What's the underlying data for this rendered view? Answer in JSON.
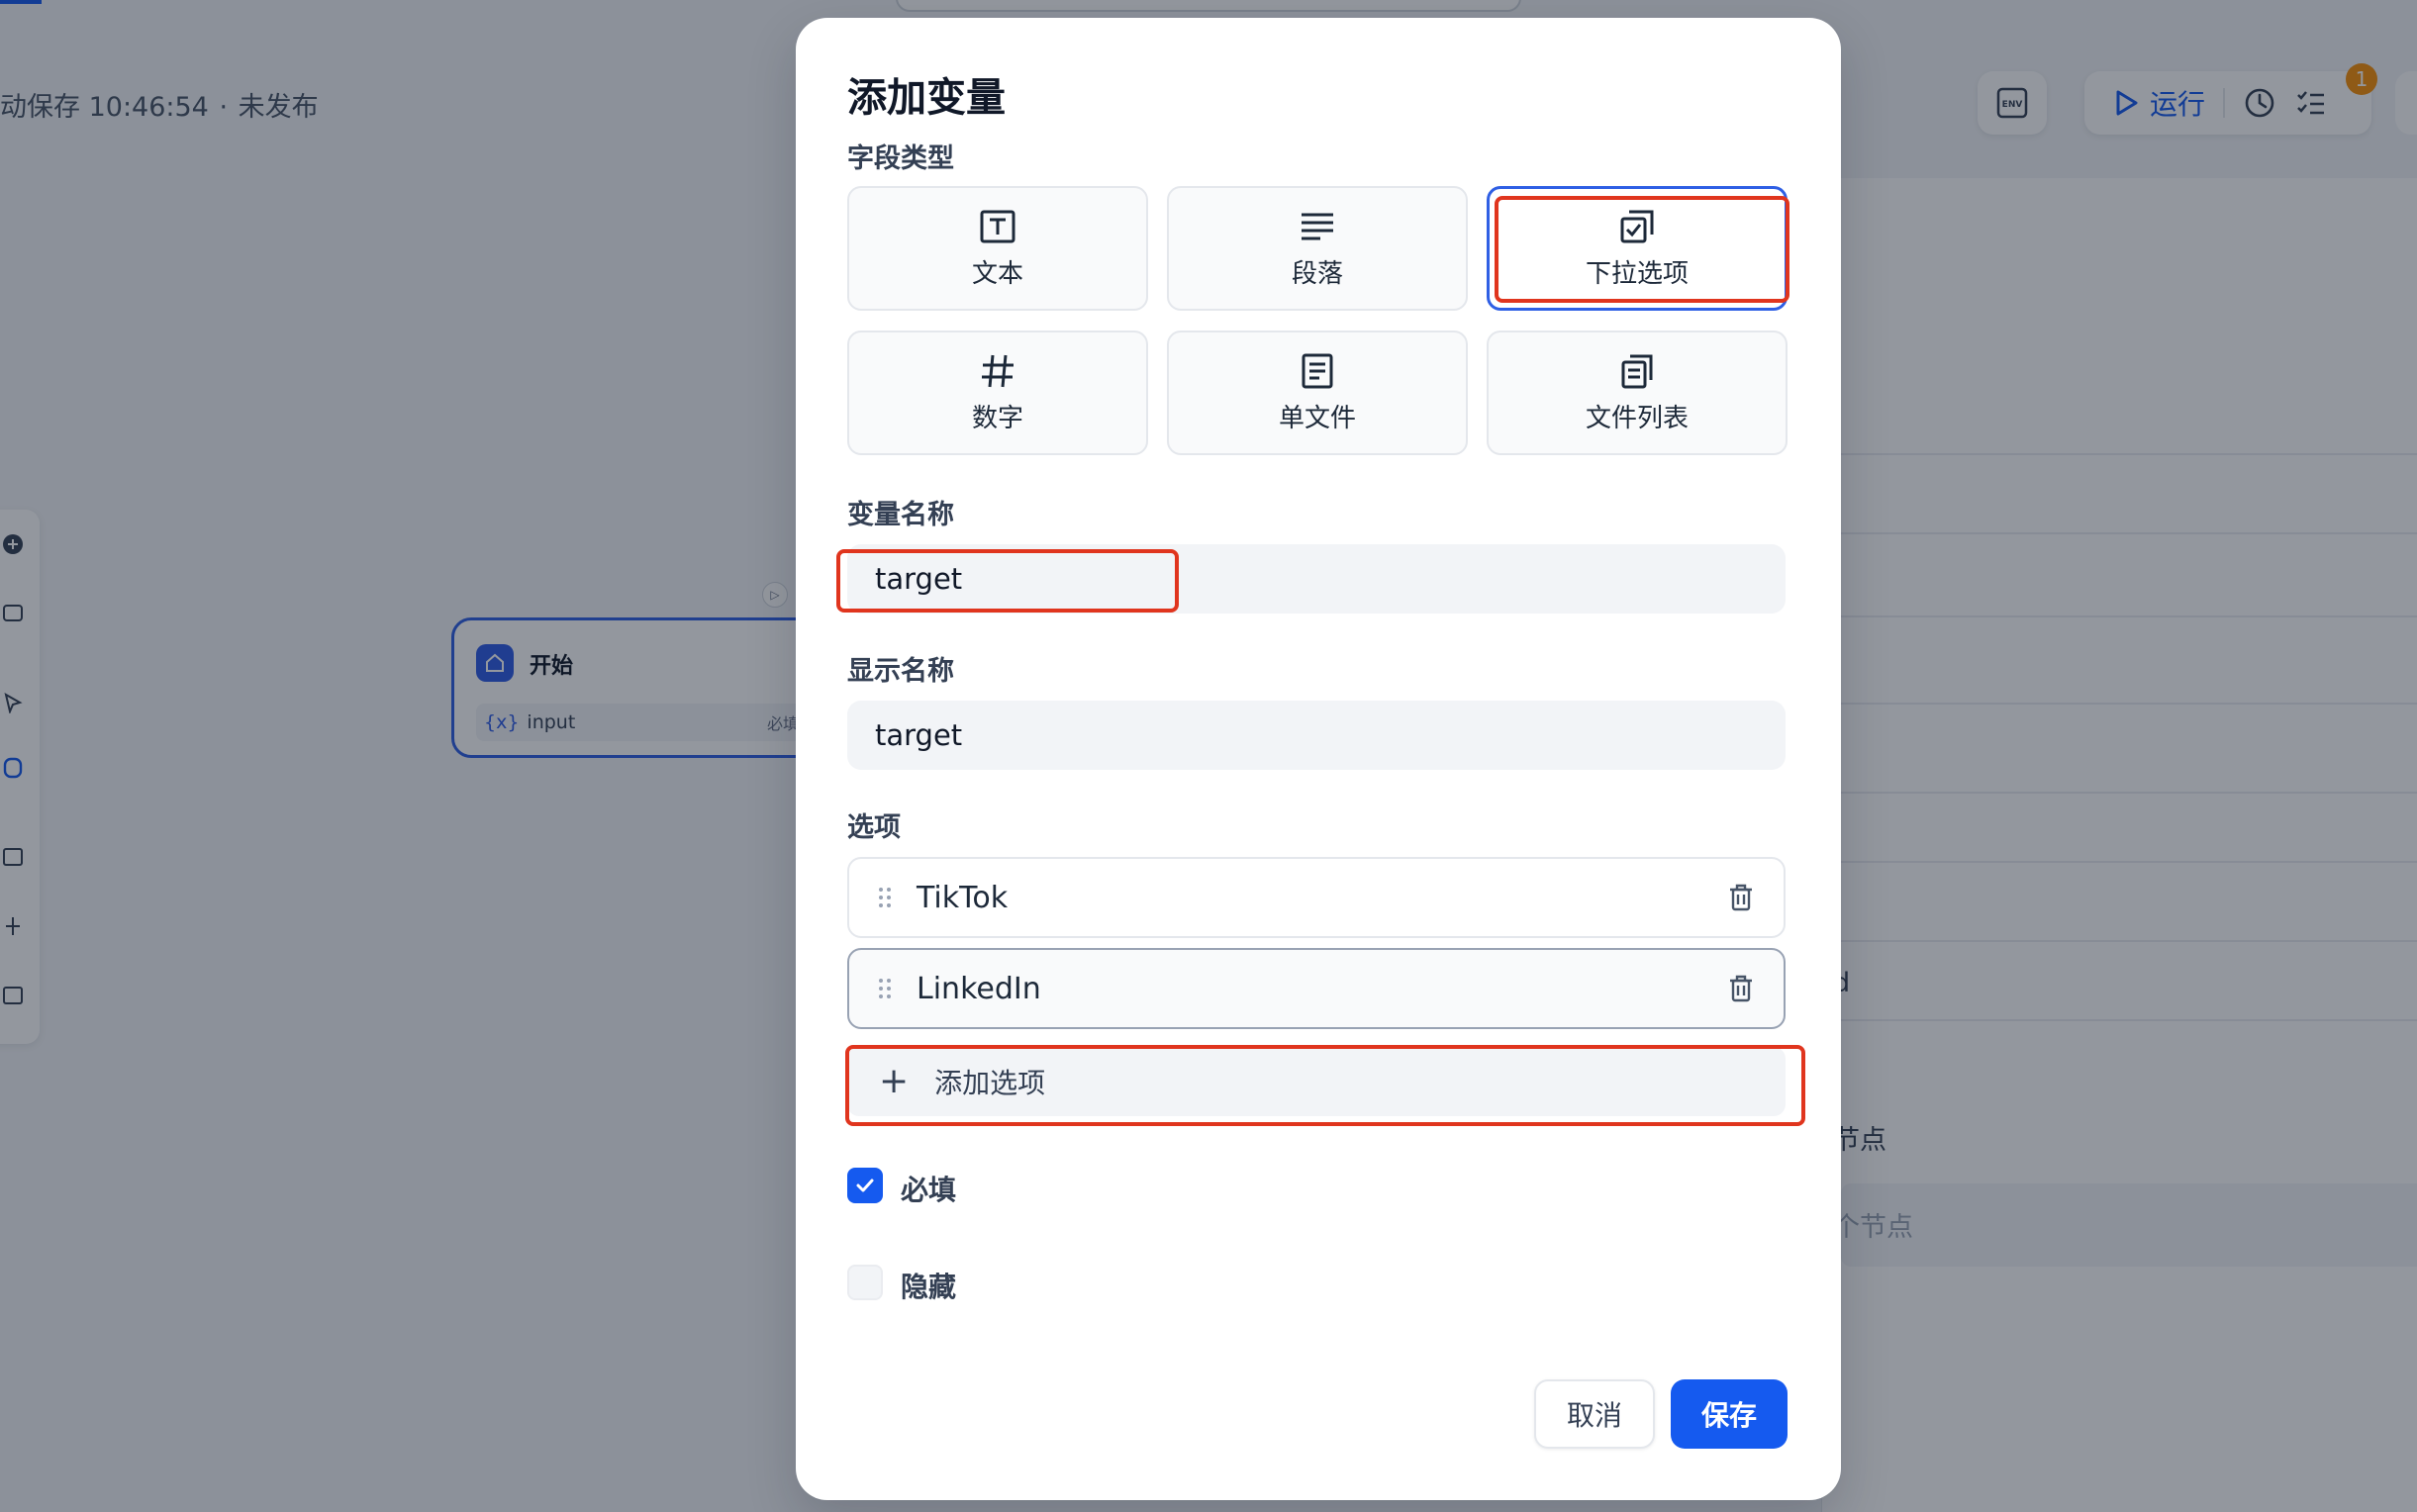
{
  "background": {
    "autosave_text": "动保存 10:46:54",
    "separator": "·",
    "publish_status": "未发布",
    "toolbar": {
      "env_label": "ENV",
      "run_label": "运行",
      "notification_count": "1"
    },
    "start_node": {
      "title": "开始",
      "var_marker": "{x}",
      "var_name": "input",
      "required_tag": "必填"
    },
    "right_panel": {
      "partial_text_1": "d",
      "partial_text_2": "节点",
      "partial_text_3": "个节点"
    }
  },
  "modal": {
    "title": "添加变量",
    "field_type_label": "字段类型",
    "field_types": [
      {
        "label": "文本",
        "icon": "text-box-icon"
      },
      {
        "label": "段落",
        "icon": "paragraph-lines-icon"
      },
      {
        "label": "下拉选项",
        "icon": "select-checkbox-icon",
        "selected": true
      },
      {
        "label": "数字",
        "icon": "hash-icon"
      },
      {
        "label": "单文件",
        "icon": "document-icon"
      },
      {
        "label": "文件列表",
        "icon": "files-icon"
      }
    ],
    "var_name_label": "变量名称",
    "var_name_value": "target",
    "display_name_label": "显示名称",
    "display_name_value": "target",
    "options_label": "选项",
    "options": [
      "TikTok",
      "LinkedIn"
    ],
    "add_option_label": "添加选项",
    "required_label": "必填",
    "required_checked": true,
    "hidden_label": "隐藏",
    "hidden_checked": false,
    "cancel_label": "取消",
    "save_label": "保存"
  },
  "colors": {
    "primary": "#155aef",
    "annotation": "#e0351e",
    "badge": "#f79009"
  }
}
